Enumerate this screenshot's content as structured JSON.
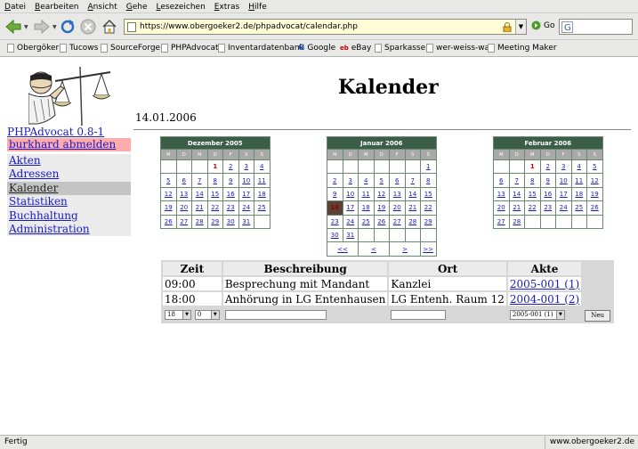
{
  "browser": {
    "menu": [
      "Datei",
      "Bearbeiten",
      "Ansicht",
      "Gehe",
      "Lesezeichen",
      "Extras",
      "Hilfe"
    ],
    "url": "https://www.obergoeker2.de/phpadvocat/calendar.php",
    "go_label": "Go",
    "bookmarks": [
      "Obergöker",
      "Tucows",
      "SourceForge",
      "PHPAdvocat",
      "Inventardatenbank",
      "Google",
      "eBay",
      "Sparkasse",
      "wer-weiss-was",
      "Meeting Maker"
    ],
    "status": "Fertig",
    "status_host": "www.obergoeker2.de"
  },
  "sidebar": {
    "app_version": "PHPAdvocat 0.8-1",
    "logout": "burkhard abmelden",
    "items": [
      {
        "label": "Akten",
        "active": false
      },
      {
        "label": "Adressen",
        "active": false
      },
      {
        "label": "Kalender",
        "active": true
      },
      {
        "label": "Statistiken",
        "active": false
      },
      {
        "label": "Buchhaltung",
        "active": false
      },
      {
        "label": "Administration",
        "active": false
      }
    ]
  },
  "page": {
    "title": "Kalender",
    "date": "14.01.2006"
  },
  "calendars": [
    {
      "title": "Dezember 2005",
      "weekdays": [
        "M",
        "D",
        "M",
        "D",
        "F",
        "S",
        "S"
      ],
      "weeks": [
        [
          "",
          "",
          "",
          "1",
          "2",
          "3",
          "4"
        ],
        [
          "5",
          "6",
          "7",
          "8",
          "9",
          "10",
          "11"
        ],
        [
          "12",
          "13",
          "14",
          "15",
          "16",
          "17",
          "18"
        ],
        [
          "19",
          "20",
          "21",
          "22",
          "23",
          "24",
          "25"
        ],
        [
          "26",
          "27",
          "28",
          "29",
          "30",
          "31",
          ""
        ]
      ],
      "today": "1",
      "selected": "",
      "nav": []
    },
    {
      "title": "Januar 2006",
      "weekdays": [
        "M",
        "D",
        "M",
        "D",
        "F",
        "S",
        "S"
      ],
      "weeks": [
        [
          "",
          "",
          "",
          "",
          "",
          "",
          "1"
        ],
        [
          "2",
          "3",
          "4",
          "5",
          "6",
          "7",
          "8"
        ],
        [
          "9",
          "10",
          "11",
          "12",
          "13",
          "14",
          "15"
        ],
        [
          "16",
          "17",
          "18",
          "19",
          "20",
          "21",
          "22"
        ],
        [
          "23",
          "24",
          "25",
          "26",
          "27",
          "28",
          "29"
        ],
        [
          "30",
          "31",
          "",
          "",
          "",
          "",
          ""
        ]
      ],
      "today": "",
      "selected": "16",
      "nav": [
        "<<",
        "<",
        ">",
        ">>"
      ]
    },
    {
      "title": "Februar 2006",
      "weekdays": [
        "M",
        "D",
        "M",
        "D",
        "F",
        "S",
        "S"
      ],
      "weeks": [
        [
          "",
          "",
          "1",
          "2",
          "3",
          "4",
          "5"
        ],
        [
          "6",
          "7",
          "8",
          "9",
          "10",
          "11",
          "12"
        ],
        [
          "13",
          "14",
          "15",
          "16",
          "17",
          "18",
          "19"
        ],
        [
          "20",
          "21",
          "22",
          "23",
          "24",
          "25",
          "26"
        ],
        [
          "27",
          "28",
          "",
          "",
          "",
          "",
          ""
        ]
      ],
      "today": "1",
      "selected": "",
      "nav": []
    }
  ],
  "appointments": {
    "headers": {
      "time": "Zeit",
      "desc": "Beschreibung",
      "place": "Ort",
      "file": "Akte"
    },
    "rows": [
      {
        "time": "09:00",
        "desc": "Besprechung mit Mandant",
        "place": "Kanzlei",
        "file": "2005-001 (1)"
      },
      {
        "time": "18:00",
        "desc": "Anhörung in LG Entenhausen",
        "place": "LG Entenh. Raum 12",
        "file": "2004-001 (2)"
      }
    ],
    "new_row": {
      "hour": "18",
      "minute": "0",
      "file": "2005-001 (1)",
      "button": "Neu"
    }
  }
}
